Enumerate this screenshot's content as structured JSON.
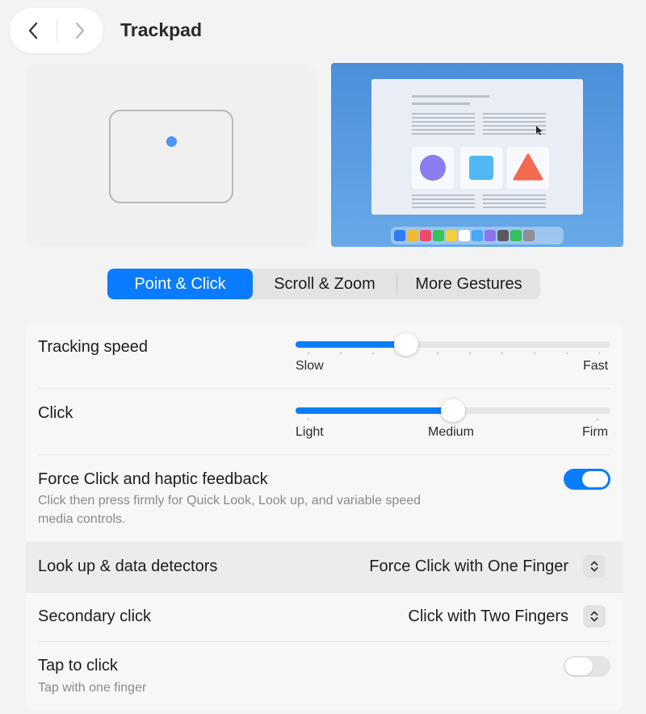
{
  "header": {
    "title": "Trackpad"
  },
  "tabs": [
    {
      "label": "Point & Click",
      "active": true
    },
    {
      "label": "Scroll & Zoom",
      "active": false
    },
    {
      "label": "More Gestures",
      "active": false
    }
  ],
  "settings": {
    "tracking_speed": {
      "label": "Tracking speed",
      "min_label": "Slow",
      "max_label": "Fast",
      "value_fraction": 0.35
    },
    "click": {
      "label": "Click",
      "labels": [
        "Light",
        "Medium",
        "Firm"
      ],
      "value_fraction": 0.5
    },
    "force_click": {
      "label": "Force Click and haptic feedback",
      "description_line1": "Click then press firmly for Quick Look, Look up, and variable speed",
      "description_line2": "media controls.",
      "enabled": true
    },
    "look_up": {
      "label": "Look up & data detectors",
      "value": "Force Click with One Finger"
    },
    "secondary_click": {
      "label": "Secondary click",
      "value": "Click with Two Fingers"
    },
    "tap_to_click": {
      "label": "Tap to click",
      "description": "Tap with one finger",
      "enabled": false
    }
  },
  "colors": {
    "accent": "#0a7cff",
    "window_bg": "#f3f3f3"
  },
  "icons": {
    "back": "chevron-left-icon",
    "forward": "chevron-right-icon",
    "popup": "up-down-chevron-icon"
  }
}
